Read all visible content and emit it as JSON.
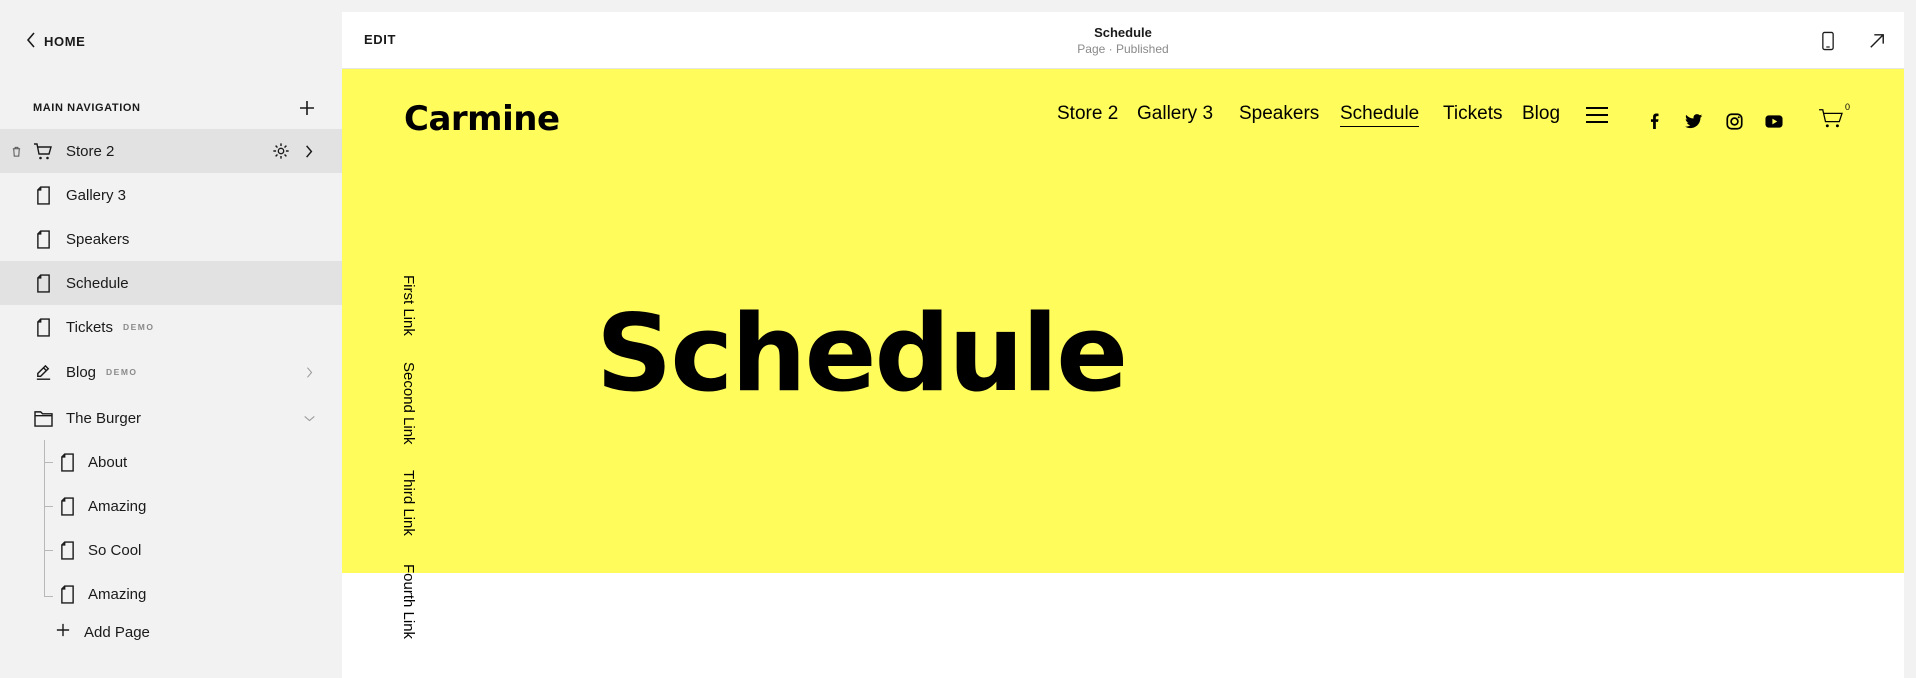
{
  "sidebar": {
    "home_label": "HOME",
    "section_title": "MAIN NAVIGATION",
    "items": [
      {
        "label": "Store 2",
        "badge": ""
      },
      {
        "label": "Gallery 3",
        "badge": ""
      },
      {
        "label": "Speakers",
        "badge": ""
      },
      {
        "label": "Schedule",
        "badge": ""
      },
      {
        "label": "Tickets",
        "badge": "DEMO"
      },
      {
        "label": "Blog",
        "badge": "DEMO"
      },
      {
        "label": "The Burger",
        "badge": ""
      }
    ],
    "children": [
      {
        "label": "About"
      },
      {
        "label": "Amazing"
      },
      {
        "label": "So Cool"
      },
      {
        "label": "Amazing"
      }
    ],
    "add_page_label": "Add Page"
  },
  "topbar": {
    "edit_label": "EDIT",
    "page_title": "Schedule",
    "page_status": "Page · Published"
  },
  "site": {
    "brand": "Carmine",
    "nav": [
      "Store 2",
      "Gallery 3",
      "Speakers",
      "Schedule",
      "Tickets",
      "Blog"
    ],
    "active_nav": "Schedule",
    "cart_count": "0",
    "hero_title": "Schedule",
    "vertical_links": [
      "First Link",
      "Second Link",
      "Third Link",
      "Fourth Link"
    ],
    "hero_color": "#fffc5c",
    "social_icons": [
      "facebook-icon",
      "twitter-icon",
      "instagram-icon",
      "youtube-icon"
    ]
  }
}
